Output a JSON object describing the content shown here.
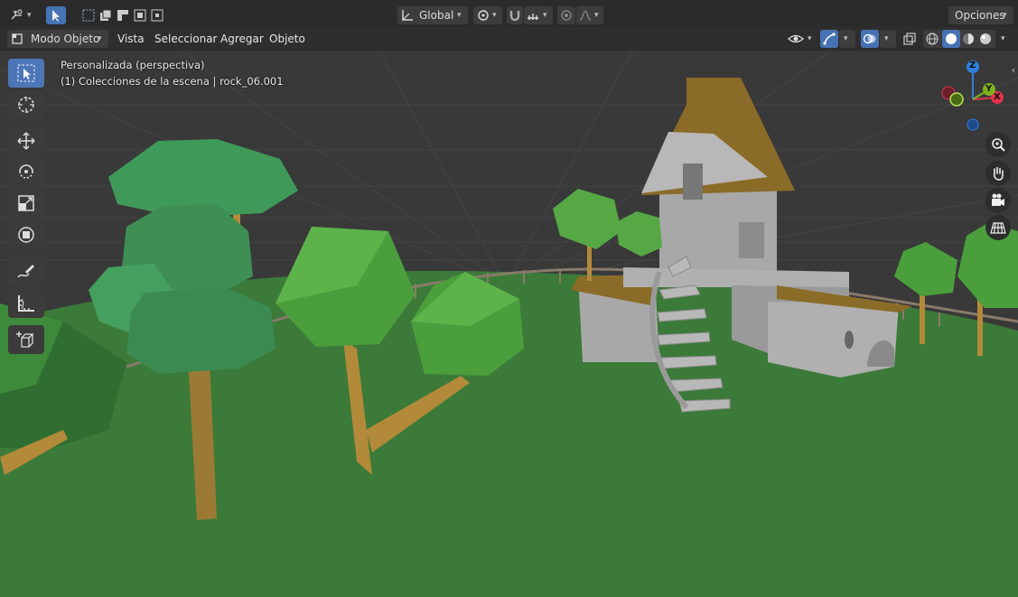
{
  "topbar": {
    "orientation_label": "Global",
    "options_label": "Opciones"
  },
  "header": {
    "mode_label": "Modo Objeto",
    "menus": [
      "Vista",
      "Seleccionar",
      "Agregar",
      "Objeto"
    ]
  },
  "viewport": {
    "view_name": "Personalizada (perspectiva)",
    "collection_info": "(1) Colecciones de la escena | rock_06.001"
  },
  "gizmo": {
    "z_label": "Z",
    "y_label": "Y",
    "x_label": "X"
  },
  "colors": {
    "accent": "#4772b3",
    "ground": "#3b7a38",
    "x_axis": "#e0334a",
    "y_axis": "#7fb11d",
    "z_axis": "#2f7fdc"
  }
}
